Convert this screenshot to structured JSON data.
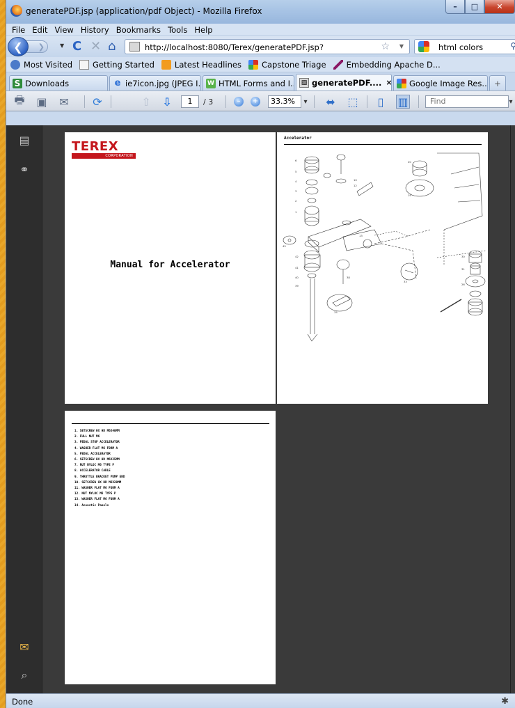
{
  "window": {
    "title": "generatePDF.jsp (application/pdf Object) - Mozilla Firefox",
    "min_glyph": "–",
    "max_glyph": "□",
    "close_glyph": "✕"
  },
  "menu": [
    "File",
    "Edit",
    "View",
    "History",
    "Bookmarks",
    "Tools",
    "Help"
  ],
  "nav": {
    "back_glyph": "❮",
    "forward_glyph": "❯",
    "dropdown_glyph": "▼",
    "reload_glyph": "C",
    "stop_glyph": "✕",
    "home_glyph": "⌂",
    "url": "http://localhost:8080/Terex/generatePDF.jsp?",
    "star_glyph": "☆",
    "search_text": "html colors",
    "search_glyph": "⚲"
  },
  "bookmarks": [
    {
      "label": "Most Visited",
      "icon": "globe-icon",
      "color": "#4b7ac9"
    },
    {
      "label": "Getting Started",
      "icon": "page-icon",
      "color": "#f5f5f5"
    },
    {
      "label": "Latest Headlines",
      "icon": "rss-icon",
      "color": "#f29b1f"
    },
    {
      "label": "Capstone Triage",
      "icon": "google-icon",
      "color": "#4285f4"
    },
    {
      "label": "Embedding Apache D...",
      "icon": "feather-icon",
      "color": "#8b1a66"
    }
  ],
  "tabs": [
    {
      "label": "Downloads",
      "icon": "downloads-icon",
      "color": "#2e8b3a",
      "glyph": "S"
    },
    {
      "label": "ie7icon.jpg (JPEG I...",
      "icon": "ie-icon",
      "color": "#2b6fd6",
      "glyph": "e"
    },
    {
      "label": "HTML Forms and I...",
      "icon": "w3-icon",
      "color": "#59b34a",
      "glyph": "W"
    },
    {
      "label": "generatePDF....",
      "icon": "pdf-icon",
      "color": "#d8d8d8",
      "glyph": "▧",
      "close": "×"
    },
    {
      "label": "Google Image Res...",
      "icon": "google-icon",
      "color": "#4285f4",
      "glyph": ""
    },
    {
      "label": "",
      "icon": "new-tab-icon",
      "color": "#c9d9ee",
      "glyph": "+"
    }
  ],
  "pdf_toolbar": {
    "page_current": "1",
    "page_total": "/ 3",
    "zoom": "33.3%",
    "zoom_drop_glyph": "▾",
    "zoom_out_glyph": "–",
    "zoom_in_glyph": "+",
    "find_placeholder": "Find",
    "find_drop_glyph": "▾",
    "print_glyph": "🖶",
    "save_glyph": "▣",
    "email_glyph": "✉",
    "sign_glyph": "⟳",
    "prev_glyph": "⇧",
    "next_glyph": "⇩",
    "fit_width_glyph": "⬌",
    "fit_page_glyph": "⬚",
    "single_page_glyph": "▯",
    "two_page_glyph": "▥"
  },
  "left_panel": {
    "pages_glyph": "▤",
    "attachments_glyph": "⚭",
    "comments_glyph": "✉",
    "clip_glyph": "⌕"
  },
  "pdf": {
    "logo_text": "TEREX",
    "logo_sub": "CORPORATION",
    "page1_title": "Manual for Accelerator",
    "page2_title": "Accelerator",
    "parts": [
      "1. SETSCREW HX HD M6X40MM",
      "2. FULL NUT M6",
      "3. PEDAL STOP ACCELERATOR",
      "4. WASHER FLAT M6 FORM A",
      "5. PEDAL ACCELERATOR",
      "6. SETSCREW HX HD M6X25MM",
      "7. NUT NYLOC M6 TYPE P",
      "8. ACCELERATOR CABLE",
      "9. THROTTLE BRACKET PUMP END",
      "10. SETSCREW HX HD M6X20MM",
      "11. WASHER FLAT M6 FORM A",
      "12. NUT NYLOC M6 TYPE P",
      "13. WASHER FLAT M6 FORM A",
      "14. Acoustic Panels"
    ]
  },
  "status": {
    "text": "Done",
    "icon_glyph": "✱"
  }
}
